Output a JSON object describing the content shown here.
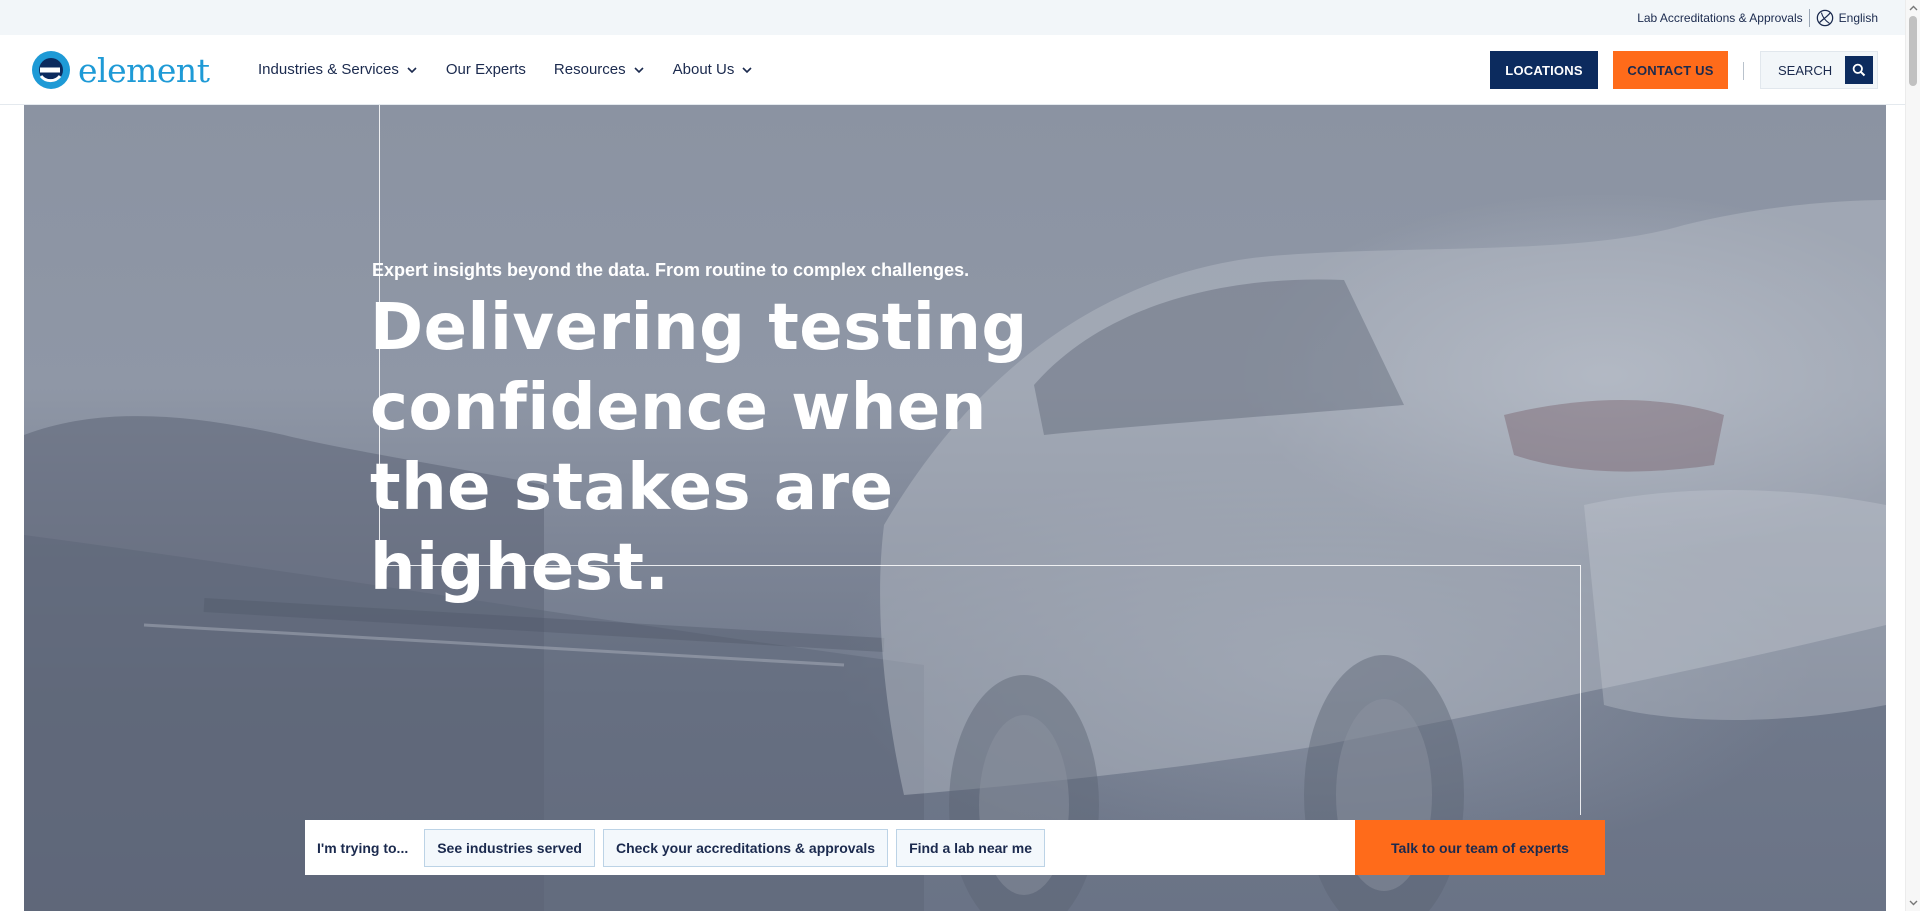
{
  "utility_bar": {
    "accreditations_link": "Lab Accreditations & Approvals",
    "language_label": "English",
    "language_icon": "globe-icon"
  },
  "header": {
    "logo_text": "element",
    "brand_color": "#1e9ad6",
    "nav": [
      {
        "label": "Industries & Services",
        "has_dropdown": true
      },
      {
        "label": "Our Experts",
        "has_dropdown": false
      },
      {
        "label": "Resources",
        "has_dropdown": true
      },
      {
        "label": "About Us",
        "has_dropdown": true
      }
    ],
    "locations_label": "LOCATIONS",
    "contact_label": "CONTACT US",
    "search_label": "SEARCH",
    "search_icon": "search-icon",
    "navy": "#0c2b5e",
    "orange": "#ff6b1a"
  },
  "hero": {
    "eyebrow": "Expert insights beyond the data. From routine to complex challenges.",
    "headline": "Delivering testing confidence when the stakes are highest."
  },
  "cta_bar": {
    "prompt": "I'm trying to...",
    "chips": [
      {
        "label": "See industries served"
      },
      {
        "label": "Check your accreditations & approvals"
      },
      {
        "label": "Find a lab near me"
      }
    ],
    "primary_label": "Talk to our team of experts"
  }
}
